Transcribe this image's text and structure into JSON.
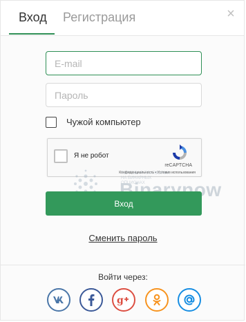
{
  "tabs": [
    {
      "label": "Вход",
      "active": true
    },
    {
      "label": "Регистрация",
      "active": false
    }
  ],
  "close_icon": "close-icon",
  "form": {
    "email_placeholder": "E-mail",
    "email_value": "",
    "password_placeholder": "Пароль",
    "password_value": "",
    "remember_label": "Чужой компьютер",
    "remember_checked": false
  },
  "captcha": {
    "label": "Я не робот",
    "brand": "reCAPTCHA",
    "links": "Конфиденциальность • Условия использования"
  },
  "watermark": {
    "small": "ТОРГОВАЯ ПЛАТФОРМА НА БИНАРНЫХ ОПЦИОНАХ",
    "brand": "Binarynow"
  },
  "login_button": "Вход",
  "change_password_link": "Сменить пароль",
  "login_with_label": "Войти через:",
  "social": [
    {
      "name": "vk",
      "glyph": "vk",
      "color": "#4a76a8"
    },
    {
      "name": "facebook",
      "glyph": "f",
      "color": "#3b5998"
    },
    {
      "name": "google-plus",
      "glyph": "g+",
      "color": "#dc4e41"
    },
    {
      "name": "odnoklassniki",
      "glyph": "ok",
      "color": "#f7931e"
    },
    {
      "name": "mail",
      "glyph": "@",
      "color": "#168de2"
    }
  ],
  "colors": {
    "accent": "#33995b",
    "tab_underline": "#2e8f55"
  }
}
